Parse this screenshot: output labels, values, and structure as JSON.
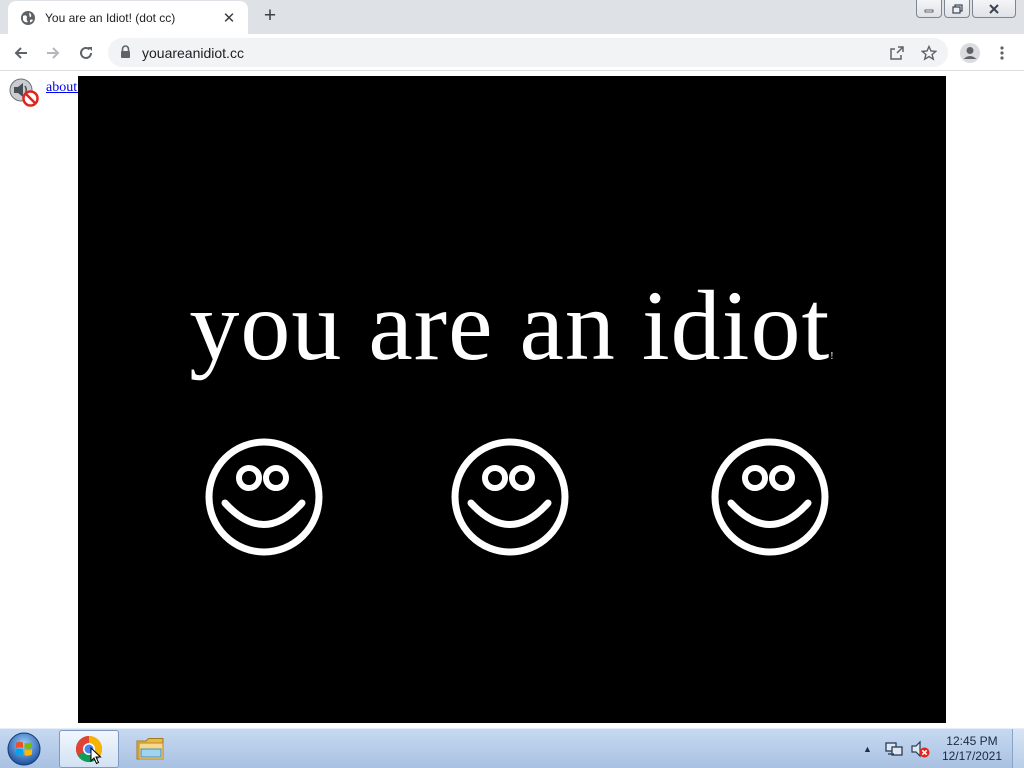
{
  "browser": {
    "tab": {
      "title": "You are an Idiot! (dot cc)",
      "favicon": "globe-icon",
      "close_glyph": "✕"
    },
    "new_tab_glyph": "+",
    "address": {
      "url": "youareanidiot.cc"
    },
    "toolbar_icons": [
      "back-arrow-icon",
      "forward-arrow-icon",
      "reload-icon",
      "lock-icon",
      "share-icon",
      "star-icon",
      "profile-icon",
      "kebab-menu-icon"
    ]
  },
  "page": {
    "about_link": "about:blank",
    "headline": "you are an idiot",
    "headline_mark": "!",
    "smiley_count": 3
  },
  "taskbar": {
    "pinned": [
      "chrome-icon",
      "file-explorer-icon"
    ],
    "tray_arrow": "▲",
    "clock": {
      "time": "12:45 PM",
      "date": "12/17/2021"
    }
  },
  "colors": {
    "stage_background": "#000000",
    "headline_color": "#ffffff",
    "link_color": "#0000ee",
    "tabstrip": "#dee1e6"
  }
}
